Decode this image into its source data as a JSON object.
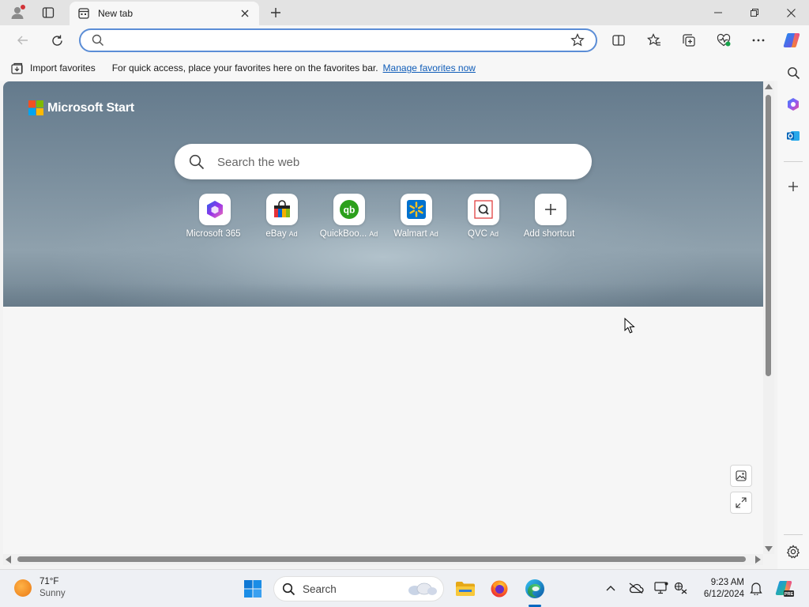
{
  "browser": {
    "tab": {
      "title": "New tab"
    },
    "address_bar": {
      "value": "",
      "placeholder": ""
    },
    "favorites_bar": {
      "import_label": "Import favorites",
      "message": "For quick access, place your favorites here on the favorites bar.",
      "manage_link": "Manage favorites now"
    },
    "icons": {
      "profile": "profile-icon",
      "tab_actions": "tab-actions-icon",
      "new_tab": "plus-icon",
      "minimize": "minimize-icon",
      "restore": "restore-icon",
      "close": "close-icon",
      "back": "back-arrow-icon",
      "refresh": "refresh-icon",
      "split_screen": "split-screen-icon",
      "favorites": "favorites-icon",
      "collections": "collections-icon",
      "browser_essentials": "browser-essentials-icon",
      "more": "ellipsis-icon",
      "copilot": "copilot-icon"
    },
    "accent_color": "#5b8dd6"
  },
  "newtab": {
    "brand": "Microsoft Start",
    "search_placeholder": "Search the web",
    "shortcuts": [
      {
        "label": "Microsoft 365",
        "ad": ""
      },
      {
        "label": "eBay",
        "ad": "Ad"
      },
      {
        "label": "QuickBoo...",
        "ad": "Ad"
      },
      {
        "label": "Walmart",
        "ad": "Ad"
      },
      {
        "label": "QVC",
        "ad": "Ad"
      },
      {
        "label": "Add shortcut",
        "ad": ""
      }
    ]
  },
  "sidebar": {
    "items": [
      "search-icon",
      "copilot-app-icon",
      "outlook-icon",
      "add-icon",
      "settings-icon"
    ]
  },
  "taskbar": {
    "weather": {
      "temp": "71°F",
      "condition": "Sunny"
    },
    "search_label": "Search",
    "clock": {
      "time": "9:23 AM",
      "date": "6/12/2024"
    },
    "pinned": [
      "start-icon",
      "search",
      "file-explorer-icon",
      "firefox-icon",
      "edge-icon"
    ],
    "tray": [
      "chevron-up-icon",
      "onedrive-icon",
      "display-icon",
      "network-icon",
      "notifications-icon",
      "copilot-icon"
    ]
  }
}
